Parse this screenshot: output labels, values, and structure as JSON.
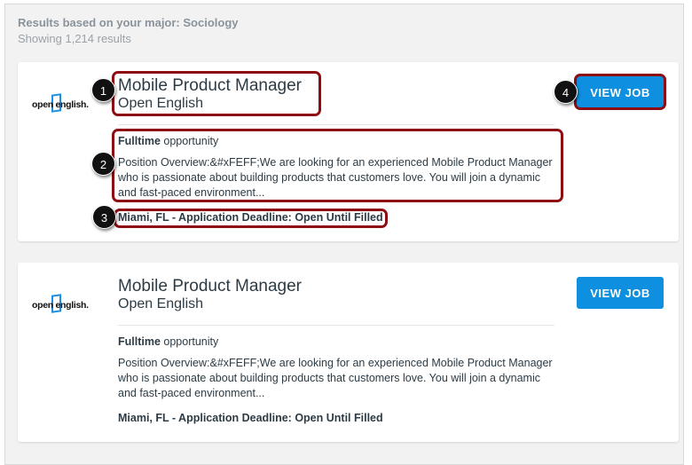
{
  "header": {
    "major_line": "Results based on your major: Sociology",
    "count_line": "Showing 1,214 results"
  },
  "jobs": [
    {
      "logo_text": "open english.",
      "title": "Mobile Product Manager",
      "company": "Open English",
      "type_bold": "Fulltime",
      "type_rest": " opportunity",
      "description": "Position Overview:&#xFEFF;We are looking for an experienced Mobile Product Manager who is passionate about building products that customers love. You will join a dynamic and fast-paced environment...",
      "location": "Miami, FL - Application Deadline: Open Until Filled",
      "button": "VIEW JOB"
    },
    {
      "logo_text": "open english.",
      "title": "Mobile Product Manager",
      "company": "Open English",
      "type_bold": "Fulltime",
      "type_rest": " opportunity",
      "description": "Position Overview:&#xFEFF;We are looking for an experienced Mobile Product Manager who is passionate about building products that customers love. You will join a dynamic and fast-paced environment...",
      "location": "Miami, FL - Application Deadline: Open Until Filled",
      "button": "VIEW JOB"
    }
  ],
  "annotations": [
    "1",
    "2",
    "3",
    "4"
  ],
  "colors": {
    "accent": "#0f8fe0",
    "annotation": "#8d0d12"
  }
}
